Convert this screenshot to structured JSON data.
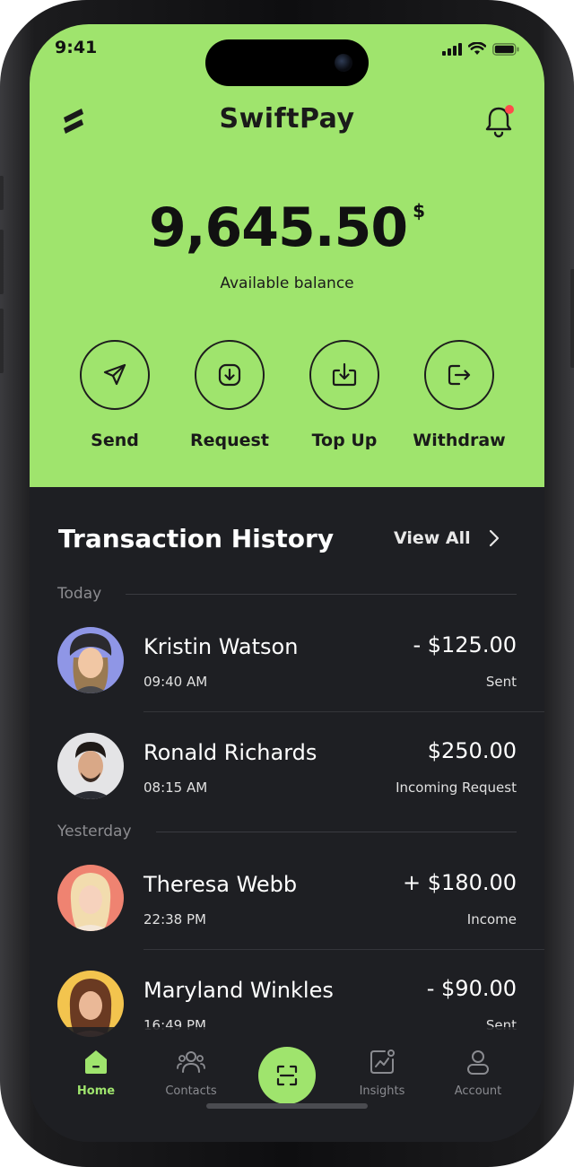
{
  "status_bar": {
    "time": "9:41"
  },
  "header": {
    "title": "SwiftPay"
  },
  "balance": {
    "amount": "9,645.50",
    "currency": "$",
    "label": "Available balance"
  },
  "actions": [
    {
      "label": "Send",
      "icon": "send-icon"
    },
    {
      "label": "Request",
      "icon": "request-icon"
    },
    {
      "label": "Top Up",
      "icon": "top-up-icon"
    },
    {
      "label": "Withdraw",
      "icon": "withdraw-icon"
    }
  ],
  "history": {
    "title": "Transaction History",
    "view_all": "View All",
    "groups": [
      {
        "day": "Today",
        "transactions": [
          {
            "name": "Kristin Watson",
            "time": "09:40 AM",
            "amount": "- $125.00",
            "status": "Sent"
          },
          {
            "name": "Ronald Richards",
            "time": "08:15 AM",
            "amount": "$250.00",
            "status": "Incoming Request"
          }
        ]
      },
      {
        "day": "Yesterday",
        "transactions": [
          {
            "name": "Theresa Webb",
            "time": "22:38 PM",
            "amount": "+ $180.00",
            "status": "Income"
          },
          {
            "name": "Maryland Winkles",
            "time": "16:49 PM",
            "amount": "- $90.00",
            "status": "Sent"
          }
        ]
      }
    ]
  },
  "tabbar": {
    "items": [
      {
        "label": "Home",
        "active": true
      },
      {
        "label": "Contacts"
      },
      {
        "label": "Insights"
      },
      {
        "label": "Account"
      }
    ]
  },
  "colors": {
    "accent": "#9fe46d",
    "background": "#1e1f23",
    "notification": "#ff4b4b"
  }
}
